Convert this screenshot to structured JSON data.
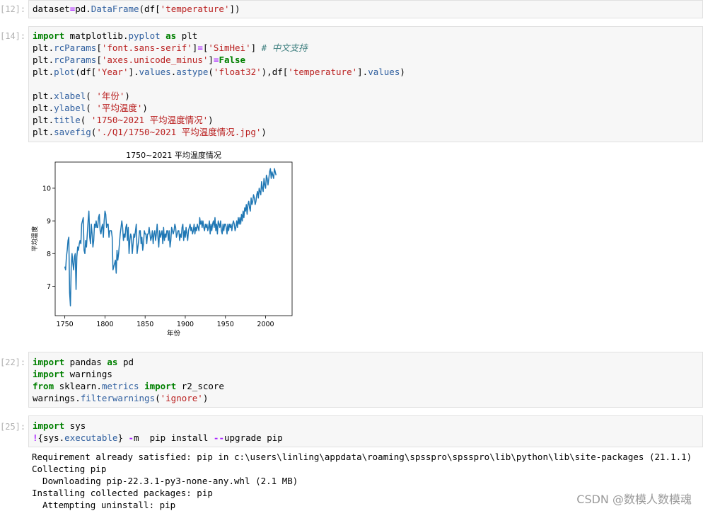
{
  "cells": [
    {
      "prompt": "[12]:",
      "lines": [
        "dataset=pd.DataFrame(df['temperature'])"
      ]
    },
    {
      "prompt": "[14]:",
      "lines": [
        "import matplotlib.pyplot as plt",
        "plt.rcParams['font.sans-serif']=['SimHei'] # 中文支持",
        "plt.rcParams['axes.unicode_minus']=False",
        "plt.plot(df['Year'].values.astype('float32'),df['temperature'].values)",
        "",
        "plt.xlabel( '年份')",
        "plt.ylabel( '平均温度')",
        "plt.title( '1750~2021 平均温度情况')",
        "plt.savefig('./Q1/1750~2021 平均温度情况.jpg')"
      ]
    },
    {
      "prompt": "[22]:",
      "lines": [
        "import pandas as pd",
        "import warnings",
        "from sklearn.metrics import r2_score",
        "warnings.filterwarnings('ignore')"
      ]
    },
    {
      "prompt": "[25]:",
      "lines": [
        "import sys",
        "!{sys.executable} -m  pip install --upgrade pip"
      ]
    }
  ],
  "output": [
    "Requirement already satisfied: pip in c:\\users\\linling\\appdata\\roaming\\spsspro\\spsspro\\lib\\python\\lib\\site-packages (21.1.1)",
    "Collecting pip",
    "  Downloading pip-22.3.1-py3-none-any.whl (2.1 MB)",
    "Installing collected packages: pip",
    "  Attempting uninstall: pip"
  ],
  "watermark": "CSDN @数模人数模魂",
  "chart_data": {
    "type": "line",
    "title": "1750~2021 平均温度情况",
    "xlabel": "年份",
    "ylabel": "平均温度",
    "xlim": [
      1738,
      2033
    ],
    "ylim": [
      6.1,
      10.8
    ],
    "xticks": [
      1750,
      1800,
      1850,
      1900,
      1950,
      2000
    ],
    "yticks": [
      7,
      8,
      9,
      10
    ],
    "color": "#1f77b4",
    "grid": false,
    "x_start": 1750,
    "values": [
      7.6,
      7.5,
      7.9,
      8.1,
      8.4,
      8.5,
      6.8,
      6.4,
      7.6,
      8.0,
      7.7,
      7.5,
      7.9,
      8.0,
      6.9,
      7.9,
      8.2,
      8.1,
      8.3,
      8.4,
      8.3,
      8.9,
      9.0,
      9.1,
      8.1,
      8.0,
      8.4,
      8.2,
      8.6,
      9.0,
      9.3,
      8.5,
      8.3,
      8.9,
      8.6,
      8.2,
      8.4,
      8.9,
      8.8,
      9.0,
      8.8,
      8.8,
      9.1,
      9.2,
      8.7,
      8.6,
      8.8,
      8.9,
      8.5,
      9.0,
      9.3,
      9.2,
      8.8,
      8.9,
      8.9,
      8.5,
      8.7,
      8.7,
      8.7,
      8.5,
      7.5,
      7.6,
      7.7,
      7.8,
      7.4,
      8.1,
      7.8,
      8.0,
      8.3,
      8.6,
      8.8,
      9.0,
      8.8,
      8.4,
      8.6,
      8.5,
      8.8,
      8.9,
      8.4,
      8.8,
      8.0,
      8.4,
      8.6,
      8.5,
      8.0,
      8.3,
      8.6,
      8.5,
      8.7,
      8.9,
      8.0,
      8.2,
      8.4,
      8.7,
      8.7,
      8.3,
      8.5,
      8.1,
      8.3,
      8.7,
      8.6,
      8.6,
      8.3,
      8.6,
      8.6,
      8.8,
      8.6,
      8.4,
      8.5,
      8.7,
      8.3,
      8.6,
      8.7,
      8.4,
      8.6,
      8.9,
      8.5,
      8.2,
      8.7,
      8.5,
      8.6,
      8.7,
      8.3,
      8.8,
      8.4,
      8.6,
      8.5,
      8.7,
      8.7,
      8.4,
      8.7,
      8.2,
      8.4,
      8.8,
      8.7,
      8.6,
      8.7,
      8.9,
      8.8,
      8.5,
      8.6,
      8.7,
      8.7,
      8.4,
      8.6,
      8.5,
      8.8,
      8.9,
      8.4,
      8.7,
      8.5,
      8.8,
      8.6,
      8.4,
      8.7,
      8.8,
      8.9,
      8.7,
      8.8,
      8.6,
      8.7,
      8.9,
      8.6,
      8.8,
      8.7,
      8.9,
      8.8,
      8.7,
      9.1,
      8.9,
      9.0,
      8.8,
      9.0,
      8.8,
      8.7,
      8.9,
      8.8,
      8.9,
      8.7,
      8.8,
      9.0,
      8.6,
      8.9,
      8.7,
      8.9,
      9.0,
      8.8,
      9.1,
      8.7,
      8.9,
      8.6,
      9.0,
      8.9,
      8.8,
      9.0,
      8.7,
      8.6,
      8.9,
      8.7,
      8.9,
      8.9,
      8.8,
      8.6,
      8.9,
      8.7,
      8.9,
      8.8,
      8.9,
      8.7,
      8.9,
      9.0,
      8.9,
      8.7,
      8.8,
      9.0,
      8.8,
      9.1,
      8.9,
      9.1,
      8.9,
      9.2,
      9.0,
      9.3,
      9.1,
      9.4,
      9.3,
      9.5,
      9.2,
      9.5,
      9.6,
      9.4,
      9.3,
      9.7,
      9.5,
      9.6,
      9.8,
      9.7,
      9.5,
      9.6,
      9.8,
      9.9,
      9.7,
      10.0,
      9.9,
      9.8,
      10.2,
      10.0,
      9.9,
      10.3,
      10.1,
      10.0,
      10.4,
      10.3,
      10.1,
      10.3,
      10.5,
      10.6,
      10.3,
      10.5,
      10.4,
      10.3,
      10.6,
      10.5,
      10.4
    ]
  }
}
